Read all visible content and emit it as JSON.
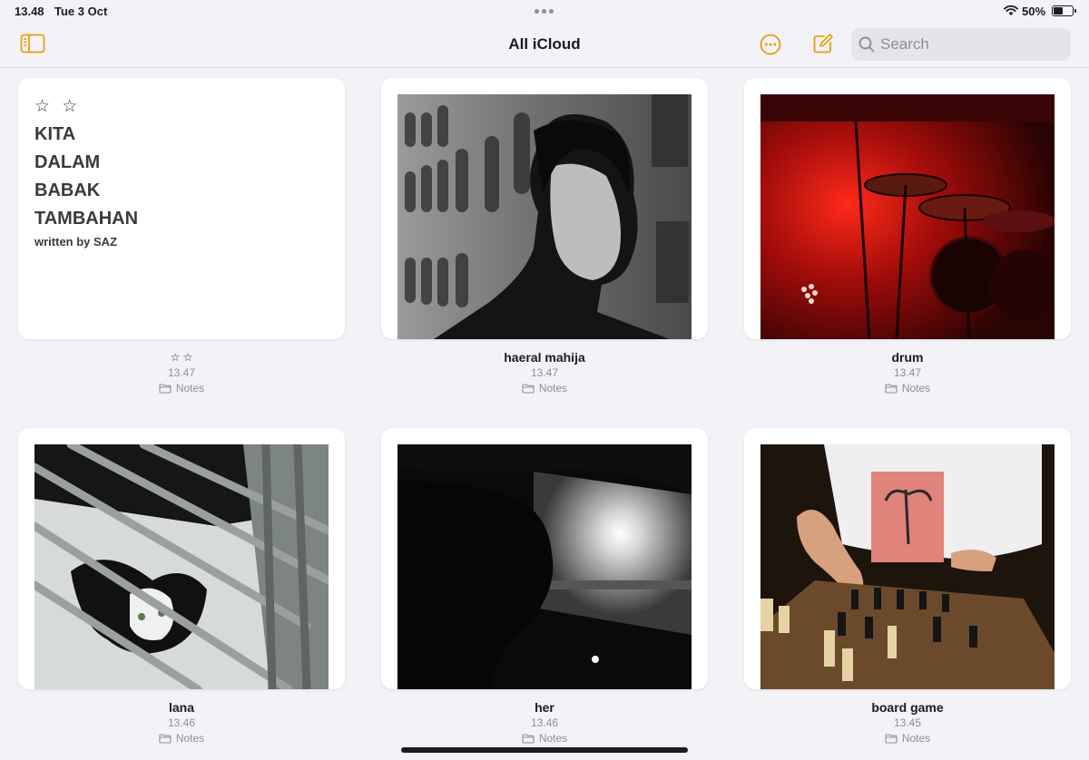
{
  "status_bar": {
    "time": "13.48",
    "date": "Tue 3 Oct",
    "battery": "50%",
    "battery_level": 0.5
  },
  "nav": {
    "title": "All iCloud",
    "search_placeholder": "Search",
    "accent_color": "#e5a00d"
  },
  "notes": [
    {
      "title": "☆ ☆",
      "time": "13.47",
      "folder": "Notes",
      "type": "text",
      "preview": {
        "stars": "☆ ☆",
        "lines": [
          "KITA",
          "DALAM",
          "BABAK",
          "TAMBAHAN"
        ],
        "byline": "written by SAZ"
      }
    },
    {
      "title": "haeral mahija",
      "time": "13.47",
      "folder": "Notes",
      "type": "image"
    },
    {
      "title": "drum",
      "time": "13.47",
      "folder": "Notes",
      "type": "image"
    },
    {
      "title": "lana",
      "time": "13.46",
      "folder": "Notes",
      "type": "image"
    },
    {
      "title": "her",
      "time": "13.46",
      "folder": "Notes",
      "type": "image"
    },
    {
      "title": "board game",
      "time": "13.45",
      "folder": "Notes",
      "type": "image"
    }
  ]
}
